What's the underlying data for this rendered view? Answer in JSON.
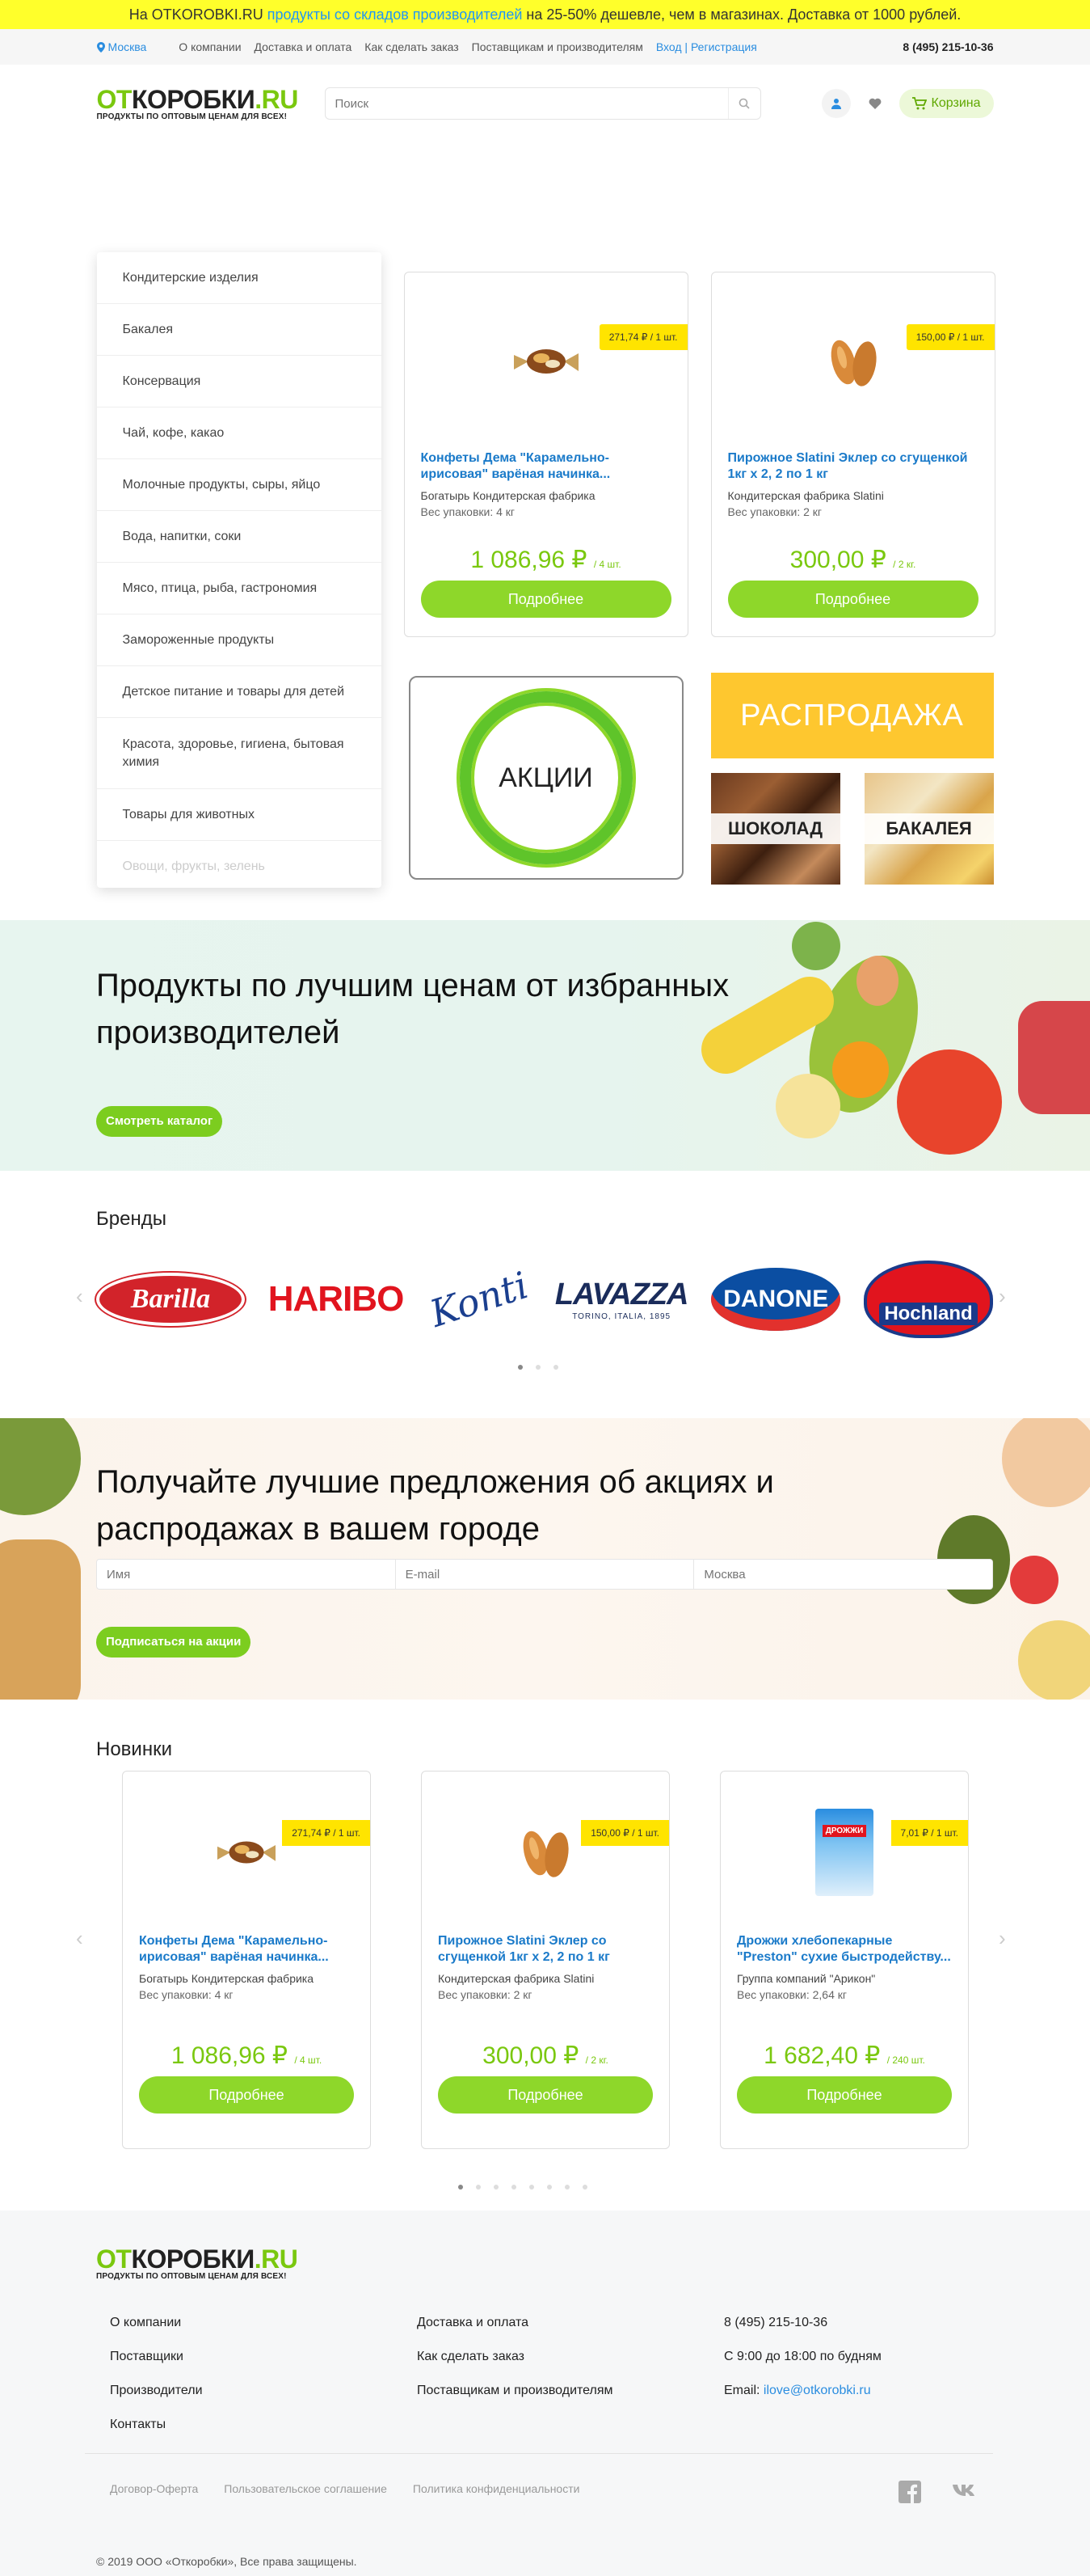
{
  "promo": {
    "pre": "На OTKOROBKI.RU ",
    "highlight": "продукты со складов производителей",
    "post": " на 25-50% дешевле, чем в магазинах. Доставка от 1000 рублей."
  },
  "topnav": {
    "city": "Москва",
    "links": [
      "О компании",
      "Доставка и оплата",
      "Как сделать заказ",
      "Поставщикам и производителям"
    ],
    "auth": "Вход | Регистрация",
    "phone": "8 (495) 215-10-36"
  },
  "logo": {
    "part1": "ОТ",
    "part2": "КОРОБКИ",
    "part3": ".RU",
    "tagline": "ПРОДУКТЫ ПО ОПТОВЫМ ЦЕНАМ ДЛЯ ВСЕХ!"
  },
  "search": {
    "placeholder": "Поиск"
  },
  "header": {
    "cart_label": "Корзина"
  },
  "categories": [
    "Кондитерские изделия",
    "Бакалея",
    "Консервация",
    "Чай, кофе, какао",
    "Молочные продукты, сыры, яйцо",
    "Вода, напитки, соки",
    "Мясо, птица, рыба, гастрономия",
    "Замороженные продукты",
    "Детское питание и товары для детей",
    "Красота, здоровье, гигиена, бытовая химия",
    "Товары для животных",
    "Овощи, фрукты, зелень"
  ],
  "hero_products": [
    {
      "name": "Конфеты Дема \"Карамельно-ирисовая\" варёная начинка...",
      "maker": "Богатырь Кондитерская фабрика",
      "weight": "Вес упаковки: 4 кг",
      "price": "1 086,96 ₽",
      "unit": "/ 4 шт.",
      "tag": "271,74 ₽ / 1 шт.",
      "button": "Подробнее"
    },
    {
      "name": "Пирожное Slatini Эклер со сгущенкой 1кг х 2, 2 по 1 кг",
      "maker": "Кондитерская фабрика Slatini",
      "weight": "Вес упаковки: 2 кг",
      "price": "300,00 ₽",
      "unit": "/ 2 кг.",
      "tag": "150,00 ₽ / 1 шт.",
      "button": "Подробнее"
    }
  ],
  "promos": {
    "akcii": "АКЦИИ",
    "sale": "РАСПРОДАЖА",
    "chocolate": "ШОКОЛАД",
    "bakaleya": "БАКАЛЕЯ"
  },
  "banner": {
    "title": "Продукты по лучшим ценам от избранных производителей",
    "button": "Смотреть каталог"
  },
  "brands": {
    "title": "Бренды",
    "items": [
      "Barilla",
      "HARIBO",
      "Konti",
      "LAVAZZA",
      "DANONE",
      "Hochland"
    ],
    "lavazza_sub": "TORINO, ITALIA, 1895"
  },
  "subscribe": {
    "title": "Получайте лучшие предложения об акциях и распродажах в вашем городе",
    "name_placeholder": "Имя",
    "email_placeholder": "E-mail",
    "city_placeholder": "Москва",
    "button": "Подписаться на акции"
  },
  "novinki": {
    "title": "Новинки",
    "items": [
      {
        "name": "Конфеты Дема \"Карамельно-ирисовая\" варёная начинка...",
        "maker": "Богатырь Кондитерская фабрика",
        "weight": "Вес упаковки: 4 кг",
        "price": "1 086,96 ₽",
        "unit": "/ 4 шт.",
        "tag": "271,74 ₽ / 1 шт.",
        "button": "Подробнее"
      },
      {
        "name": "Пирожное Slatini Эклер со сгущенкой 1кг х 2, 2 по 1 кг",
        "maker": "Кондитерская фабрика Slatini",
        "weight": "Вес упаковки: 2 кг",
        "price": "300,00 ₽",
        "unit": "/ 2 кг.",
        "tag": "150,00 ₽ / 1 шт.",
        "button": "Подробнее"
      },
      {
        "name": "Дрожжи хлебопекарные \"Preston\" сухие быстродейству...",
        "maker": "Группа компаний \"Арикон\"",
        "weight": "Вес упаковки: 2,64 кг",
        "price": "1 682,40 ₽",
        "unit": "/ 240 шт.",
        "tag": "7,01 ₽ / 1 шт.",
        "button": "Подробнее",
        "pack_label": "ДРОЖЖИ"
      }
    ]
  },
  "footer": {
    "col1": [
      "О компании",
      "Поставщики",
      "Производители",
      "Контакты"
    ],
    "col2": [
      "Доставка и оплата",
      "Как сделать заказ",
      "Поставщикам и производителям"
    ],
    "phone": "8 (495) 215-10-36",
    "hours": "С 9:00 до 18:00 по будням",
    "email_label": "Email: ",
    "email": "ilove@otkorobki.ru",
    "legal": [
      "Договор-Оферта",
      "Пользовательское соглашение",
      "Политика конфиденциальности"
    ],
    "copyright": "© 2019 ООО «Откоробки», Все права защищены."
  },
  "colors": {
    "accent_green": "#8ed72a",
    "link_blue": "#1a7ac9",
    "promo_yellow": "#ffff2b",
    "price_tag_yellow": "#ffe400",
    "sale_orange": "#fec72f"
  }
}
